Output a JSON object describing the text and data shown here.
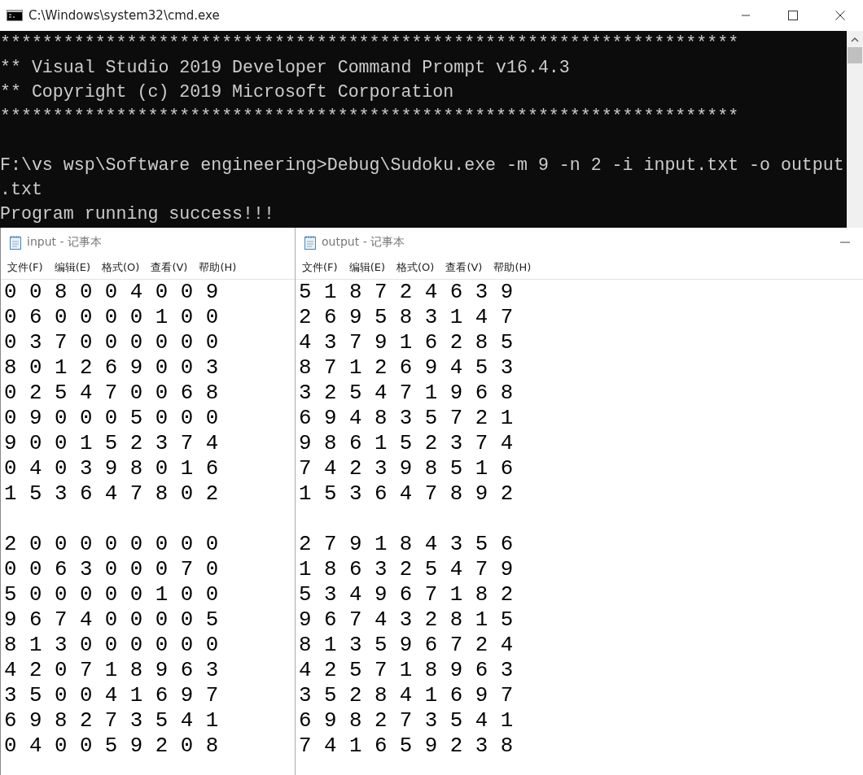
{
  "console": {
    "title": "C:\\Windows\\system32\\cmd.exe",
    "groups": [
      [
        "**********************************************************************",
        "** Visual Studio 2019 Developer Command Prompt v16.4.3",
        "** Copyright (c) 2019 Microsoft Corporation",
        "**********************************************************************"
      ],
      [
        "F:\\vs wsp\\Software engineering>Debug\\Sudoku.exe -m 9 -n 2 -i input.txt -o output",
        ".txt",
        "Program running success!!!"
      ]
    ]
  },
  "notepads": [
    {
      "title": "input - 记事本",
      "menu": [
        "文件(F)",
        "编辑(E)",
        "格式(O)",
        "查看(V)",
        "帮助(H)"
      ],
      "blocks": [
        [
          "0 0 8 0 0 4 0 0 9",
          "0 6 0 0 0 0 1 0 0",
          "0 3 7 0 0 0 0 0 0",
          "8 0 1 2 6 9 0 0 3",
          "0 2 5 4 7 0 0 6 8",
          "0 9 0 0 0 5 0 0 0",
          "9 0 0 1 5 2 3 7 4",
          "0 4 0 3 9 8 0 1 6",
          "1 5 3 6 4 7 8 0 2"
        ],
        [
          "2 0 0 0 0 0 0 0 0",
          "0 0 6 3 0 0 0 7 0",
          "5 0 0 0 0 0 1 0 0",
          "9 6 7 4 0 0 0 0 5",
          "8 1 3 0 0 0 0 0 0",
          "4 2 0 7 1 8 9 6 3",
          "3 5 0 0 4 1 6 9 7",
          "6 9 8 2 7 3 5 4 1",
          "0 4 0 0 5 9 2 0 8"
        ]
      ]
    },
    {
      "title": "output - 记事本",
      "menu": [
        "文件(F)",
        "编辑(E)",
        "格式(O)",
        "查看(V)",
        "帮助(H)"
      ],
      "blocks": [
        [
          "5 1 8 7 2 4 6 3 9",
          "2 6 9 5 8 3 1 4 7",
          "4 3 7 9 1 6 2 8 5",
          "8 7 1 2 6 9 4 5 3",
          "3 2 5 4 7 1 9 6 8",
          "6 9 4 8 3 5 7 2 1",
          "9 8 6 1 5 2 3 7 4",
          "7 4 2 3 9 8 5 1 6",
          "1 5 3 6 4 7 8 9 2"
        ],
        [
          "2 7 9 1 8 4 3 5 6",
          "1 8 6 3 2 5 4 7 9",
          "5 3 4 9 6 7 1 8 2",
          "9 6 7 4 3 2 8 1 5",
          "8 1 3 5 9 6 7 2 4",
          "4 2 5 7 1 8 9 6 3",
          "3 5 2 8 4 1 6 9 7",
          "6 9 8 2 7 3 5 4 1",
          "7 4 1 6 5 9 2 3 8"
        ]
      ]
    }
  ]
}
